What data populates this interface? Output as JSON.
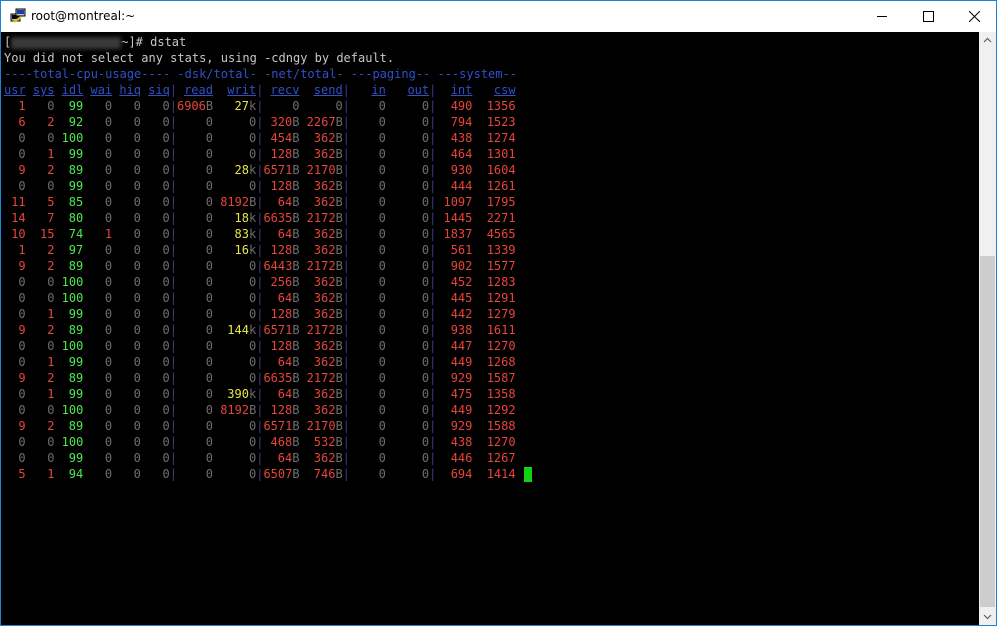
{
  "window": {
    "title": "root@montreal:~",
    "buttons": {
      "minimize": "minimize-icon",
      "maximize": "maximize-icon",
      "close": "close-icon"
    }
  },
  "terminal": {
    "prompt_open": "[",
    "prompt_rest": "~]# dstat",
    "message": "You did not select any stats, using -cdngy by default.",
    "group_header": "----total-cpu-usage---- -dsk/total- -net/total- ---paging-- ---system--",
    "columns": [
      "usr",
      "sys",
      "idl",
      "wai",
      "hiq",
      "siq",
      "read",
      "writ",
      "recv",
      "send",
      "in",
      "out",
      "int",
      "csw"
    ],
    "rows": [
      [
        "1",
        "0",
        "99",
        "0",
        "0",
        "0",
        "6906B",
        "27k",
        "0",
        "0",
        "0",
        "0",
        "490",
        "1356"
      ],
      [
        "6",
        "2",
        "92",
        "0",
        "0",
        "0",
        "0",
        "0",
        "320B",
        "2267B",
        "0",
        "0",
        "794",
        "1523"
      ],
      [
        "0",
        "0",
        "100",
        "0",
        "0",
        "0",
        "0",
        "0",
        "454B",
        "362B",
        "0",
        "0",
        "438",
        "1274"
      ],
      [
        "0",
        "1",
        "99",
        "0",
        "0",
        "0",
        "0",
        "0",
        "128B",
        "362B",
        "0",
        "0",
        "464",
        "1301"
      ],
      [
        "9",
        "2",
        "89",
        "0",
        "0",
        "0",
        "0",
        "28k",
        "6571B",
        "2170B",
        "0",
        "0",
        "930",
        "1604"
      ],
      [
        "0",
        "0",
        "99",
        "0",
        "0",
        "0",
        "0",
        "0",
        "128B",
        "362B",
        "0",
        "0",
        "444",
        "1261"
      ],
      [
        "11",
        "5",
        "85",
        "0",
        "0",
        "0",
        "0",
        "8192B",
        "64B",
        "362B",
        "0",
        "0",
        "1097",
        "1795"
      ],
      [
        "14",
        "7",
        "80",
        "0",
        "0",
        "0",
        "0",
        "18k",
        "6635B",
        "2172B",
        "0",
        "0",
        "1445",
        "2271"
      ],
      [
        "10",
        "15",
        "74",
        "1",
        "0",
        "0",
        "0",
        "83k",
        "64B",
        "362B",
        "0",
        "0",
        "1837",
        "4565"
      ],
      [
        "1",
        "2",
        "97",
        "0",
        "0",
        "0",
        "0",
        "16k",
        "128B",
        "362B",
        "0",
        "0",
        "561",
        "1339"
      ],
      [
        "9",
        "2",
        "89",
        "0",
        "0",
        "0",
        "0",
        "0",
        "6443B",
        "2172B",
        "0",
        "0",
        "902",
        "1577"
      ],
      [
        "0",
        "0",
        "100",
        "0",
        "0",
        "0",
        "0",
        "0",
        "256B",
        "362B",
        "0",
        "0",
        "452",
        "1283"
      ],
      [
        "0",
        "0",
        "100",
        "0",
        "0",
        "0",
        "0",
        "0",
        "64B",
        "362B",
        "0",
        "0",
        "445",
        "1291"
      ],
      [
        "0",
        "1",
        "99",
        "0",
        "0",
        "0",
        "0",
        "0",
        "128B",
        "362B",
        "0",
        "0",
        "442",
        "1279"
      ],
      [
        "9",
        "2",
        "89",
        "0",
        "0",
        "0",
        "0",
        "144k",
        "6571B",
        "2172B",
        "0",
        "0",
        "938",
        "1611"
      ],
      [
        "0",
        "0",
        "100",
        "0",
        "0",
        "0",
        "0",
        "0",
        "128B",
        "362B",
        "0",
        "0",
        "447",
        "1270"
      ],
      [
        "0",
        "1",
        "99",
        "0",
        "0",
        "0",
        "0",
        "0",
        "64B",
        "362B",
        "0",
        "0",
        "449",
        "1268"
      ],
      [
        "9",
        "2",
        "89",
        "0",
        "0",
        "0",
        "0",
        "0",
        "6635B",
        "2172B",
        "0",
        "0",
        "929",
        "1587"
      ],
      [
        "0",
        "1",
        "99",
        "0",
        "0",
        "0",
        "0",
        "390k",
        "64B",
        "362B",
        "0",
        "0",
        "475",
        "1358"
      ],
      [
        "0",
        "0",
        "100",
        "0",
        "0",
        "0",
        "0",
        "8192B",
        "128B",
        "362B",
        "0",
        "0",
        "449",
        "1292"
      ],
      [
        "9",
        "2",
        "89",
        "0",
        "0",
        "0",
        "0",
        "0",
        "6571B",
        "2170B",
        "0",
        "0",
        "929",
        "1588"
      ],
      [
        "0",
        "0",
        "100",
        "0",
        "0",
        "0",
        "0",
        "0",
        "468B",
        "532B",
        "0",
        "0",
        "438",
        "1270"
      ],
      [
        "0",
        "0",
        "99",
        "0",
        "0",
        "0",
        "0",
        "0",
        "64B",
        "362B",
        "0",
        "0",
        "446",
        "1267"
      ],
      [
        "5",
        "1",
        "94",
        "0",
        "0",
        "0",
        "0",
        "0",
        "6507B",
        "746B",
        "0",
        "0",
        "694",
        "1414"
      ]
    ]
  },
  "colors": {
    "red": "#e8443a",
    "green": "#4ee84e",
    "yellow": "#e8e83a",
    "gray": "#6e6e6e",
    "white": "#c8c8c8",
    "blue": "#3050c8",
    "cursor": "#12d312",
    "window_border": "#1883d7"
  }
}
